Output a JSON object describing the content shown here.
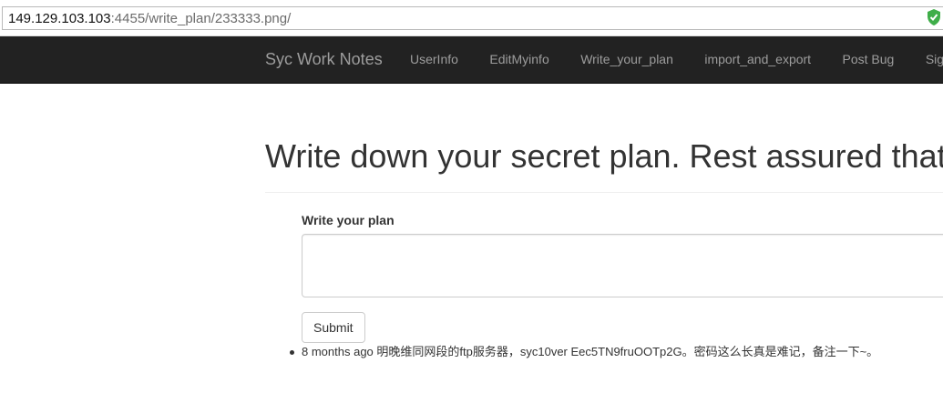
{
  "address_bar": {
    "host": "149.129.103.103",
    "rest": ":4455/write_plan/233333.png/",
    "security_icon": "green-shield-icon",
    "security_color": "#3fae49"
  },
  "navbar": {
    "brand": "Syc Work Notes",
    "links": [
      "UserInfo",
      "EditMyinfo",
      "Write_your_plan",
      "import_and_export",
      "Post Bug",
      "Sign O"
    ]
  },
  "main": {
    "heading": "Write down your secret plan. Rest assured that",
    "form": {
      "label": "Write your plan",
      "textarea_value": "",
      "submit_label": "Submit"
    },
    "notes": [
      {
        "time": "8 months ago",
        "text": "明晚维同网段的ftp服务器，syc10ver Eec5TN9fruOOTp2G。密码这么长真是难记，备注一下~。"
      }
    ]
  }
}
